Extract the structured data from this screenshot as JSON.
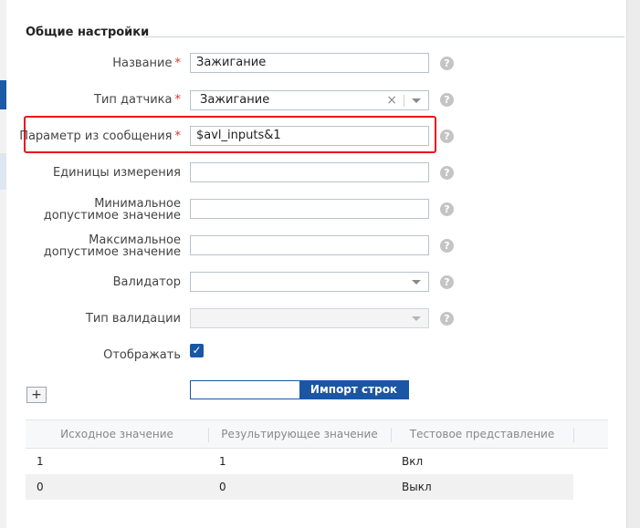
{
  "section": {
    "title": "Общие настройки"
  },
  "fields": {
    "name": {
      "label": "Название",
      "value": "Зажигание",
      "required": true
    },
    "sensor_type": {
      "label": "Тип датчика",
      "value": "Зажигание",
      "required": true
    },
    "message_param": {
      "label": "Параметр из сообщения",
      "value": "$avl_inputs&1",
      "required": true
    },
    "units": {
      "label": "Единицы измерения",
      "value": ""
    },
    "min_value": {
      "label_line1": "Минимальное",
      "label_line2": "допустимое значение",
      "value": ""
    },
    "max_value": {
      "label_line1": "Максимальное",
      "label_line2": "допустимое значение",
      "value": ""
    },
    "validator": {
      "label": "Валидатор",
      "value": ""
    },
    "validation_type": {
      "label": "Тип валидации",
      "value": ""
    },
    "display": {
      "label": "Отображать",
      "checked": true
    }
  },
  "required_mark": "*",
  "help_glyph": "?",
  "clear_glyph": "×",
  "check_glyph": "✓",
  "add_button": {
    "label": "+"
  },
  "import": {
    "button_label": "Импорт строк"
  },
  "table": {
    "columns": [
      "Исходное значение",
      "Результирующее значение",
      "Тестовое представление"
    ],
    "rows": [
      [
        "1",
        "1",
        "Вкл"
      ],
      [
        "0",
        "0",
        "Выкл"
      ]
    ]
  },
  "colors": {
    "accent": "#1a56a6",
    "highlight": "#e8151b",
    "required": "#d9342b"
  }
}
